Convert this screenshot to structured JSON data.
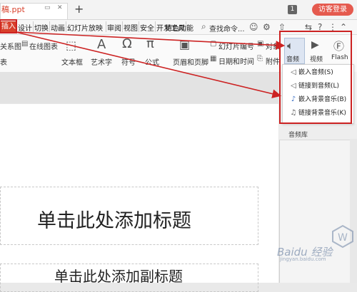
{
  "titlebar": {
    "doc_tab_label": "稿.ppt",
    "new_tab": "+",
    "badge": "1",
    "login_label": "访客登录"
  },
  "menu": {
    "insert_label": "插入",
    "items": [
      "设计",
      "切换",
      "动画",
      "幻灯片放映",
      "审阅",
      "视图",
      "安全",
      "开发工具",
      "特色功能"
    ],
    "search_label": "查找命令...",
    "help": "?"
  },
  "ribbon": {
    "row1": {
      "relationship_map": "关系图",
      "online_chart": "在线图表",
      "slide_number": "幻灯片编号",
      "object": "对象"
    },
    "row2": {
      "chart": "表",
      "textbox": "文本框",
      "wordart": "艺术字",
      "symbol": "符号",
      "formula": "公式",
      "header_footer": "页眉和页脚",
      "date_time": "日期和时间",
      "attachment": "附件"
    },
    "media": {
      "audio": "音频",
      "video": "视频",
      "flash": "Flash"
    }
  },
  "audio_menu": {
    "items": [
      "嵌入音频(S)",
      "链接到音频(L)",
      "嵌入背景音乐(B)",
      "链接背景音乐(K)"
    ]
  },
  "panel": {
    "title": "音频库"
  },
  "slide": {
    "title": "单击此处添加标题",
    "subtitle": "单击此处添加副标题"
  },
  "watermark": {
    "text": "Baidu 经验",
    "sub": "jingyan.baidu.com"
  },
  "colors": {
    "accent": "#d8402b",
    "annotation": "#cc2222",
    "login": "#e55a4e"
  }
}
